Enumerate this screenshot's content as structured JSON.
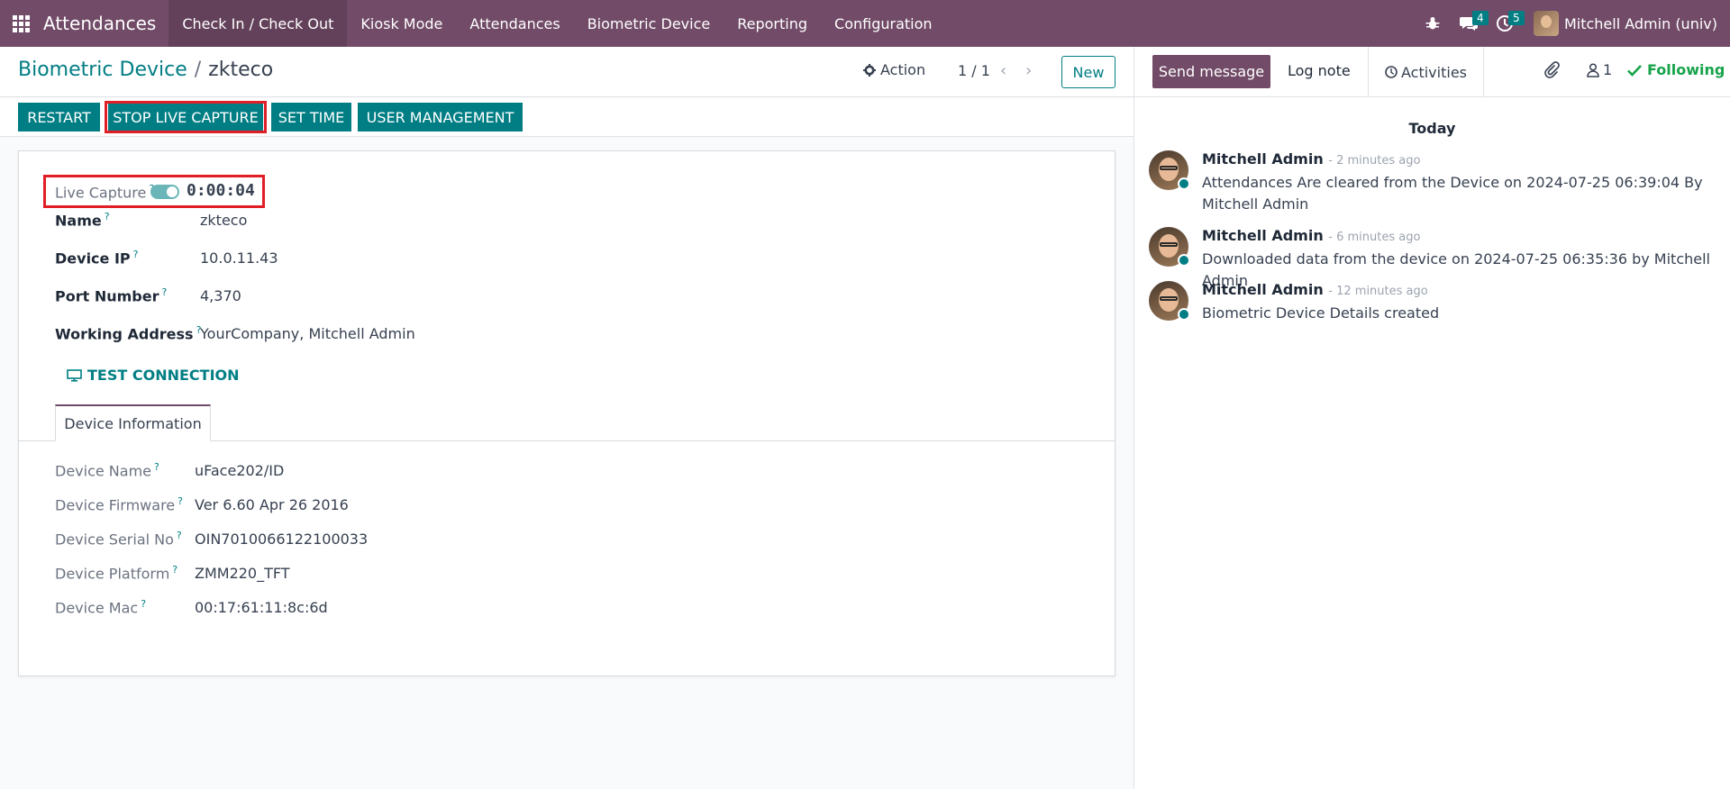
{
  "navbar": {
    "brand": "Attendances",
    "items": [
      "Check In / Check Out",
      "Kiosk Mode",
      "Attendances",
      "Biometric Device",
      "Reporting",
      "Configuration"
    ],
    "active_index": 0,
    "messages_badge": "4",
    "activities_badge": "5",
    "user": "Mitchell Admin (univ)",
    "color": "#714b67"
  },
  "control": {
    "breadcrumb_parent": "Biometric Device",
    "breadcrumb_sep": "/",
    "breadcrumb_current": "zkteco",
    "action_label": "Action",
    "pager": "1 / 1",
    "new_label": "New"
  },
  "statusbar": {
    "restart": "RESTART",
    "stop_live_capture": "STOP LIVE CAPTURE",
    "set_time": "SET TIME",
    "user_management": "USER MANAGEMENT"
  },
  "form": {
    "live_capture_label": "Live Capture",
    "help_mark": "?",
    "live_capture_timer": "0:00:04",
    "live_capture_on": true,
    "name_label": "Name",
    "name_value": "zkteco",
    "device_ip_label": "Device IP",
    "device_ip_value": "10.0.11.43",
    "port_label": "Port Number",
    "port_value": "4,370",
    "address_label": "Working Address",
    "address_value": "YourCompany, Mitchell Admin",
    "test_connection": "TEST CONNECTION",
    "tab_label": "Device Information",
    "device_name_label": "Device Name",
    "device_name_value": "uFace202/ID",
    "firmware_label": "Device Firmware",
    "firmware_value": "Ver 6.60 Apr 26 2016",
    "serial_label": "Device Serial No",
    "serial_value": "OIN7010066122100033",
    "platform_label": "Device Platform",
    "platform_value": "ZMM220_TFT",
    "mac_label": "Device Mac",
    "mac_value": "00:17:61:11:8c:6d"
  },
  "chatter": {
    "send_message": "Send message",
    "log_note": "Log note",
    "activities": "Activities",
    "followers_count": "1",
    "following": "Following",
    "today": "Today",
    "messages": [
      {
        "author": "Mitchell Admin",
        "time": "- 2 minutes ago",
        "body": "Attendances Are cleared from the Device on 2024-07-25 06:39:04 By Mitchell Admin"
      },
      {
        "author": "Mitchell Admin",
        "time": "- 6 minutes ago",
        "body": "Downloaded data from the device on 2024-07-25 06:35:36 by Mitchell Admin"
      },
      {
        "author": "Mitchell Admin",
        "time": "- 12 minutes ago",
        "body": "Biometric Device Details created"
      }
    ]
  },
  "colors": {
    "primary": "#017e84",
    "brand": "#714b67",
    "highlight": "#e11d26",
    "following": "#16a34a"
  }
}
